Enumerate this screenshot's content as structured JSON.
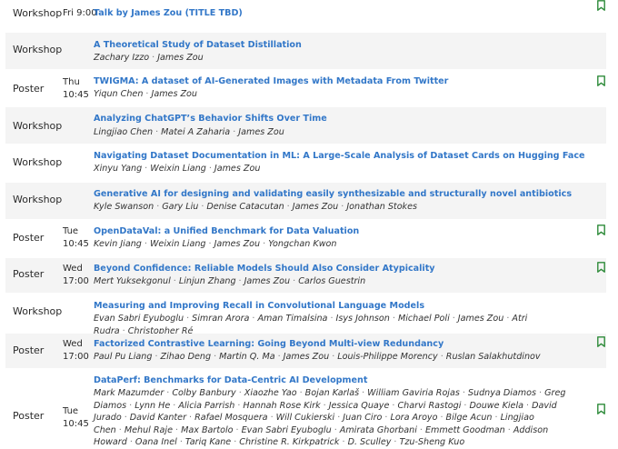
{
  "accent_color": "#3277c8",
  "bookmark_color": "#2e8b3a",
  "sessions": [
    {
      "type": "Workshop",
      "day": "Fri",
      "time": "9:00",
      "title": "Talk by James Zou (TITLE TBD)",
      "authors": [],
      "bookmark_icon": "bookmark-icon"
    },
    {
      "type": "Workshop",
      "title": "A Theoretical Study of Dataset Distillation",
      "authors": [
        "Zachary Izzo",
        "James Zou"
      ]
    },
    {
      "type": "Poster",
      "day": "Thu",
      "time": "10:45",
      "title": "TWIGMA: A dataset of AI-Generated Images with Metadata From Twitter",
      "authors": [
        "Yiqun Chen",
        "James Zou"
      ],
      "bookmark_icon": "bookmark-icon"
    },
    {
      "type": "Workshop",
      "title": "Analyzing ChatGPT’s Behavior Shifts Over Time",
      "authors": [
        "Lingjiao Chen",
        "Matei A Zaharia",
        "James Zou"
      ]
    },
    {
      "type": "Workshop",
      "title": "Navigating Dataset Documentation in ML: A Large-Scale Analysis of Dataset Cards on Hugging Face",
      "authors": [
        "Xinyu Yang",
        "Weixin Liang",
        "James Zou"
      ]
    },
    {
      "type": "Workshop",
      "title": "Generative AI for designing and validating easily synthesizable and structurally novel antibiotics",
      "authors": [
        "Kyle Swanson",
        "Gary Liu",
        "Denise Catacutan",
        "James Zou",
        "Jonathan Stokes"
      ]
    },
    {
      "type": "Poster",
      "day": "Tue",
      "time": "10:45",
      "title": "OpenDataVal: a Unified Benchmark for Data Valuation",
      "authors": [
        "Kevin Jiang",
        "Weixin Liang",
        "James Zou",
        "Yongchan Kwon"
      ],
      "bookmark_icon": "bookmark-icon"
    },
    {
      "type": "Poster",
      "day": "Wed",
      "time": "17:00",
      "title": "Beyond Confidence: Reliable Models Should Also Consider Atypicality",
      "authors": [
        "Mert Yuksekgonul",
        "Linjun Zhang",
        "James Zou",
        "Carlos Guestrin"
      ],
      "bookmark_icon": "bookmark-icon"
    },
    {
      "type": "Workshop",
      "title": "Measuring and Improving Recall in Convolutional Language Models",
      "authors": [
        "Evan Sabri Eyuboglu",
        "Simran Arora",
        "Aman Timalsina",
        "Isys Johnson",
        "Michael Poli",
        "James Zou",
        "Atri Rudra",
        "Christopher Ré"
      ]
    },
    {
      "type": "Poster",
      "day": "Wed",
      "time": "17:00",
      "title": "Factorized Contrastive Learning: Going Beyond Multi-view Redundancy",
      "authors": [
        "Paul Pu Liang",
        "Zihao Deng",
        "Martin Q. Ma",
        "James Zou",
        "Louis-Philippe Morency",
        "Ruslan Salakhutdinov"
      ],
      "bookmark_icon": "bookmark-icon"
    },
    {
      "type": "Poster",
      "day": "Tue",
      "time": "10:45",
      "title": "DataPerf: Benchmarks for Data-Centric AI Development",
      "authors": [
        "Mark Mazumder",
        "Colby Banbury",
        "Xiaozhe Yao",
        "Bojan Karlaš",
        "William Gaviria Rojas",
        "Sudnya Diamos",
        "Greg Diamos",
        "Lynn He",
        "Alicia Parrish",
        "Hannah Rose Kirk",
        "Jessica Quaye",
        "Charvi Rastogi",
        "Douwe Kiela",
        "David Jurado",
        "David Kanter",
        "Rafael Mosquera",
        "Will Cukierski",
        "Juan Ciro",
        "Lora Aroyo",
        "Bilge Acun",
        "Lingjiao Chen",
        "Mehul Raje",
        "Max Bartolo",
        "Evan Sabri Eyuboglu",
        "Amirata Ghorbani",
        "Emmett Goodman",
        "Addison Howard",
        "Oana Inel",
        "Tariq Kane",
        "Christine R. Kirkpatrick",
        "D. Sculley",
        "Tzu-Sheng Kuo"
      ],
      "bookmark_icon": "bookmark-icon"
    }
  ]
}
